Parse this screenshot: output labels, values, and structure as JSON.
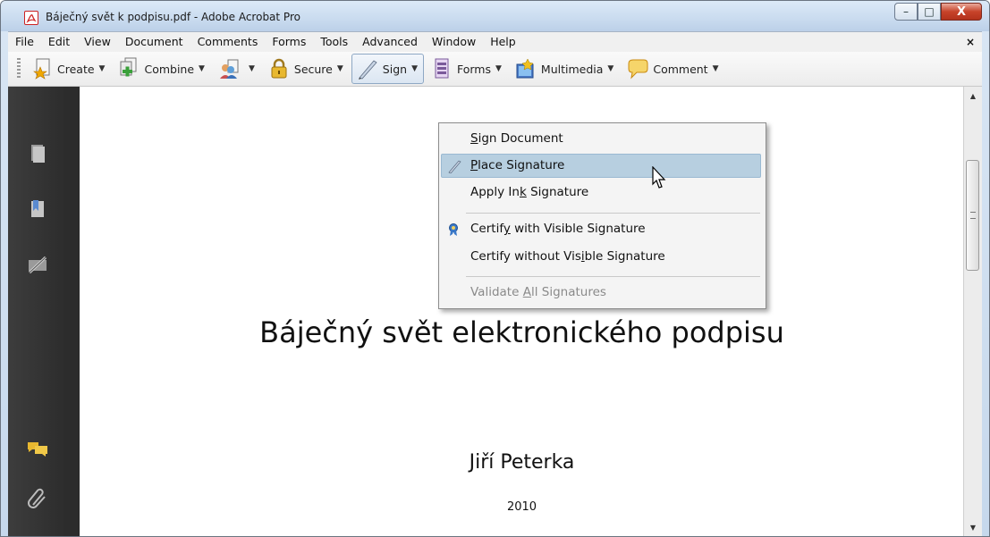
{
  "window": {
    "title": "Báječný svět k podpisu.pdf - Adobe Acrobat Pro",
    "controls": {
      "minimize": "–",
      "maximize": "□",
      "close": "X"
    }
  },
  "menubar": {
    "items": [
      "File",
      "Edit",
      "View",
      "Document",
      "Comments",
      "Forms",
      "Tools",
      "Advanced",
      "Window",
      "Help"
    ],
    "close_glyph": "×"
  },
  "toolbar": {
    "buttons": [
      {
        "label": "Create",
        "icon": "create-icon"
      },
      {
        "label": "Combine",
        "icon": "combine-icon"
      },
      {
        "label": "",
        "icon": "collaborate-icon"
      },
      {
        "label": "Secure",
        "icon": "lock-icon"
      },
      {
        "label": "Sign",
        "icon": "pen-icon",
        "active": true
      },
      {
        "label": "Forms",
        "icon": "forms-icon"
      },
      {
        "label": "Multimedia",
        "icon": "multimedia-icon"
      },
      {
        "label": "Comment",
        "icon": "comment-icon"
      }
    ],
    "arrow": "▼"
  },
  "navigation_pane": {
    "icons": [
      "pages-icon",
      "bookmarks-icon",
      "signatures-icon",
      "comments-icon",
      "attachments-icon"
    ]
  },
  "sign_menu": {
    "items": [
      {
        "label": "Sign Document",
        "accel_index": 0
      },
      {
        "label": "Place Signature",
        "accel_index": 0,
        "highlighted": true,
        "icon": "pen-icon"
      },
      {
        "label": "Apply Ink Signature",
        "accel_index": 8
      },
      {
        "label": "Certify with Visible Signature",
        "accel_index": 6,
        "icon": "certify-ribbon-icon"
      },
      {
        "label": "Certify without Visible Signature",
        "accel_index": 19
      },
      {
        "label": "Validate All Signatures",
        "accel_index": 9,
        "disabled": true
      }
    ]
  },
  "document": {
    "title": "Báječný svět elektronického podpisu",
    "author": "Jiří Peterka",
    "year": "2010"
  },
  "colors": {
    "menu_highlight": "#b7cfe0",
    "nav_pane": "#333333",
    "page": "#ffffff"
  }
}
